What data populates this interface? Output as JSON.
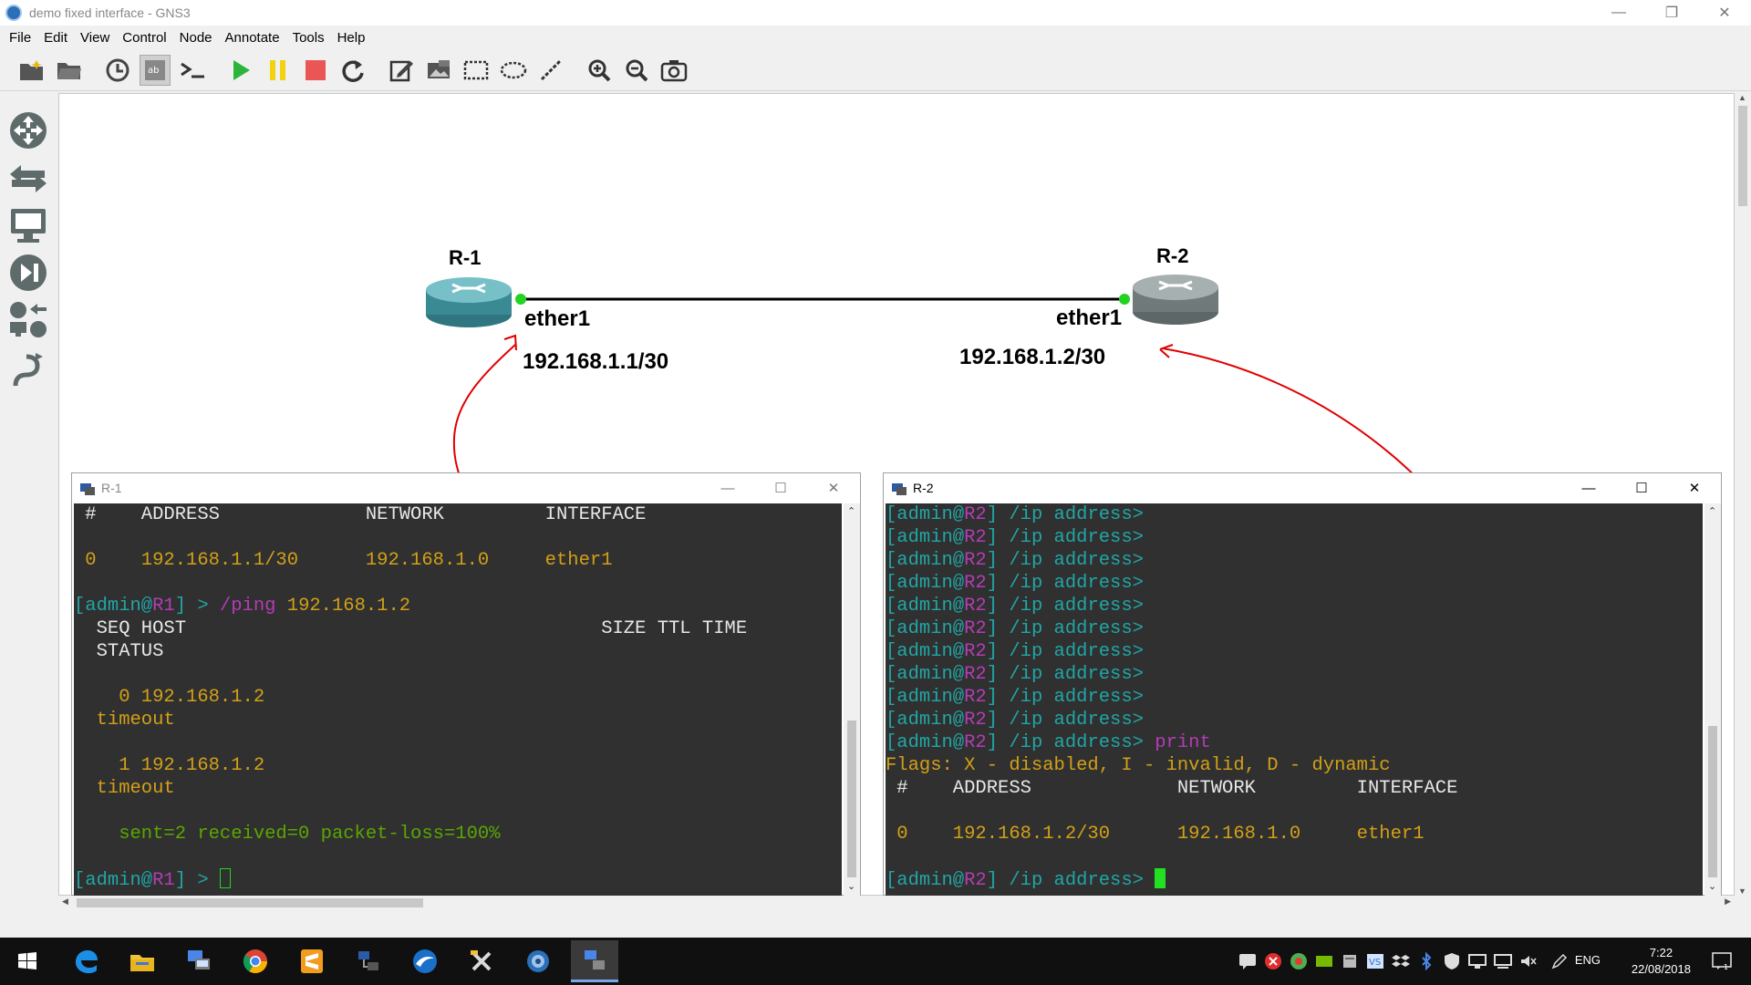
{
  "window": {
    "title": "demo fixed interface - GNS3"
  },
  "menu": [
    "File",
    "Edit",
    "View",
    "Control",
    "Node",
    "Annotate",
    "Tools",
    "Help"
  ],
  "toolbar_icons": [
    "new-project-icon",
    "open-project-icon",
    "snapshot-icon",
    "show-interface-labels-icon",
    "console-all-icon",
    "start-all-icon",
    "suspend-all-icon",
    "stop-all-icon",
    "reload-all-icon",
    "add-note-icon",
    "insert-picture-icon",
    "draw-rectangle-icon",
    "draw-ellipse-icon",
    "draw-line-icon",
    "zoom-in-icon",
    "zoom-out-icon",
    "screenshot-icon"
  ],
  "dock_icons": [
    "browse-routers-icon",
    "browse-switches-icon",
    "browse-end-devices-icon",
    "browse-security-devices-icon",
    "browse-all-devices-icon",
    "add-link-icon"
  ],
  "topology": {
    "nodes": [
      {
        "name": "R-1",
        "interface": "ether1",
        "ip": "192.168.1.1/30"
      },
      {
        "name": "R-2",
        "interface": "ether1",
        "ip": "192.168.1.2/30"
      }
    ]
  },
  "console_r1": {
    "title": "R-1",
    "lines": [
      [
        {
          "t": " #    ADDRESS             NETWORK         INTERFACE",
          "c": "wht"
        }
      ],
      [
        {
          "t": "",
          "c": "wht"
        }
      ],
      [
        {
          "t": " 0    192.168.1.1/30      192.168.1.0     ether1",
          "c": "yel"
        }
      ],
      [
        {
          "t": "",
          "c": "wht"
        }
      ],
      [
        {
          "t": "[admin@",
          "c": "cyan"
        },
        {
          "t": "R1",
          "c": "mag"
        },
        {
          "t": "] > ",
          "c": "cyan"
        },
        {
          "t": "/ping",
          "c": "mag"
        },
        {
          "t": " 192.168.1.2",
          "c": "yel"
        }
      ],
      [
        {
          "t": "  SEQ HOST                                     SIZE TTL TIME",
          "c": "wht"
        }
      ],
      [
        {
          "t": "  STATUS",
          "c": "wht"
        }
      ],
      [
        {
          "t": "",
          "c": "wht"
        }
      ],
      [
        {
          "t": "    0 192.168.1.2",
          "c": "yel"
        }
      ],
      [
        {
          "t": "  timeout",
          "c": "yel"
        }
      ],
      [
        {
          "t": "",
          "c": "wht"
        }
      ],
      [
        {
          "t": "    1 192.168.1.2",
          "c": "yel"
        }
      ],
      [
        {
          "t": "  timeout",
          "c": "yel"
        }
      ],
      [
        {
          "t": "",
          "c": "wht"
        }
      ],
      [
        {
          "t": "    sent=2 received=0 packet-loss=100%",
          "c": "grn"
        }
      ],
      [
        {
          "t": "",
          "c": "wht"
        }
      ],
      [
        {
          "t": "[admin@",
          "c": "cyan"
        },
        {
          "t": "R1",
          "c": "mag"
        },
        {
          "t": "] > ",
          "c": "cyan"
        }
      ]
    ]
  },
  "console_r2": {
    "title": "R-2",
    "lines": [
      [
        {
          "t": "[admin@",
          "c": "cyan"
        },
        {
          "t": "R2",
          "c": "mag"
        },
        {
          "t": "] /ip address>",
          "c": "cyan"
        }
      ],
      [
        {
          "t": "[admin@",
          "c": "cyan"
        },
        {
          "t": "R2",
          "c": "mag"
        },
        {
          "t": "] /ip address>",
          "c": "cyan"
        }
      ],
      [
        {
          "t": "[admin@",
          "c": "cyan"
        },
        {
          "t": "R2",
          "c": "mag"
        },
        {
          "t": "] /ip address>",
          "c": "cyan"
        }
      ],
      [
        {
          "t": "[admin@",
          "c": "cyan"
        },
        {
          "t": "R2",
          "c": "mag"
        },
        {
          "t": "] /ip address>",
          "c": "cyan"
        }
      ],
      [
        {
          "t": "[admin@",
          "c": "cyan"
        },
        {
          "t": "R2",
          "c": "mag"
        },
        {
          "t": "] /ip address>",
          "c": "cyan"
        }
      ],
      [
        {
          "t": "[admin@",
          "c": "cyan"
        },
        {
          "t": "R2",
          "c": "mag"
        },
        {
          "t": "] /ip address>",
          "c": "cyan"
        }
      ],
      [
        {
          "t": "[admin@",
          "c": "cyan"
        },
        {
          "t": "R2",
          "c": "mag"
        },
        {
          "t": "] /ip address>",
          "c": "cyan"
        }
      ],
      [
        {
          "t": "[admin@",
          "c": "cyan"
        },
        {
          "t": "R2",
          "c": "mag"
        },
        {
          "t": "] /ip address>",
          "c": "cyan"
        }
      ],
      [
        {
          "t": "[admin@",
          "c": "cyan"
        },
        {
          "t": "R2",
          "c": "mag"
        },
        {
          "t": "] /ip address>",
          "c": "cyan"
        }
      ],
      [
        {
          "t": "[admin@",
          "c": "cyan"
        },
        {
          "t": "R2",
          "c": "mag"
        },
        {
          "t": "] /ip address>",
          "c": "cyan"
        }
      ],
      [
        {
          "t": "[admin@",
          "c": "cyan"
        },
        {
          "t": "R2",
          "c": "mag"
        },
        {
          "t": "] /ip address> ",
          "c": "cyan"
        },
        {
          "t": "print",
          "c": "mag"
        }
      ],
      [
        {
          "t": "Flags: X - disabled, I - invalid, D - dynamic",
          "c": "yel"
        }
      ],
      [
        {
          "t": " #    ADDRESS             NETWORK         INTERFACE",
          "c": "wht"
        }
      ],
      [
        {
          "t": "",
          "c": "wht"
        }
      ],
      [
        {
          "t": " 0    192.168.1.2/30      192.168.1.0     ether1",
          "c": "yel"
        }
      ],
      [
        {
          "t": "",
          "c": "wht"
        }
      ],
      [
        {
          "t": "[admin@",
          "c": "cyan"
        },
        {
          "t": "R2",
          "c": "mag"
        },
        {
          "t": "] /ip address> ",
          "c": "cyan"
        }
      ]
    ]
  },
  "taskbar": {
    "apps": [
      "windows-start-icon",
      "edge-browser-icon",
      "file-explorer-icon",
      "network-connections-icon",
      "chrome-icon",
      "sublime-text-icon",
      "network-app-icon",
      "wireshark-icon",
      "tools-app-icon",
      "gns3-icon",
      "gns3-console-icon"
    ],
    "tray_icons": [
      "chat-icon",
      "antivirus-icon",
      "network-shield-icon",
      "nvidia-icon",
      "storage-icon",
      "vs-icon",
      "dropbox-icon",
      "bluetooth-icon",
      "security-icon",
      "display-icon",
      "network-icon",
      "volume-icon",
      "pen-icon"
    ],
    "language": "ENG",
    "time": "7:22",
    "date": "22/08/2018"
  },
  "colors": {
    "annotation": "#e00000",
    "link_up": "#22d322",
    "terminal_bg": "#303030"
  }
}
